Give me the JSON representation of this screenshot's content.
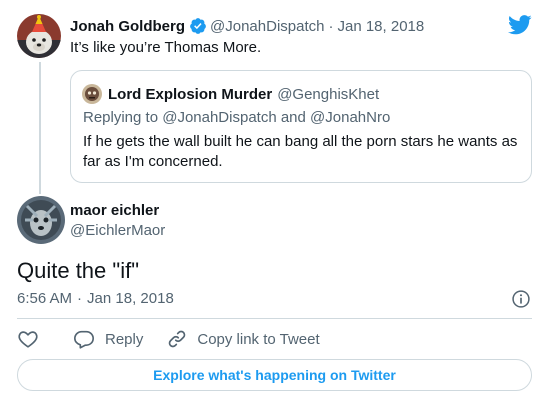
{
  "parent_tweet": {
    "display_name": "Jonah Goldberg",
    "handle": "@JonahDispatch",
    "separator": "·",
    "date": "Jan 18, 2018",
    "text": "It’s like you’re Thomas More.",
    "verified": true
  },
  "quoted_tweet": {
    "display_name": "Lord Explosion Murder",
    "handle": "@GenghisKhet",
    "replying_to": "Replying to @JonahDispatch and @JonahNro",
    "text": "If he gets the wall built he can bang all the porn stars he wants as far as I'm concerned."
  },
  "main_tweet": {
    "display_name": "maor eichler",
    "handle": "@EichlerMaor",
    "text": "Quite the \"if\"",
    "time": "6:56 AM",
    "separator": "·",
    "date": "Jan 18, 2018"
  },
  "actions": {
    "reply_label": "Reply",
    "copy_label": "Copy link to Tweet"
  },
  "explore_label": "Explore what's happening on Twitter",
  "icons": {
    "brand": "twitter-bird-icon",
    "verified": "verified-badge-icon",
    "info": "info-icon",
    "like": "heart-icon",
    "reply": "speech-bubble-icon",
    "copy": "link-icon"
  },
  "colors": {
    "accent": "#1d9bf0",
    "text": "#0f1419",
    "muted": "#536471",
    "border": "#cfd9de"
  }
}
